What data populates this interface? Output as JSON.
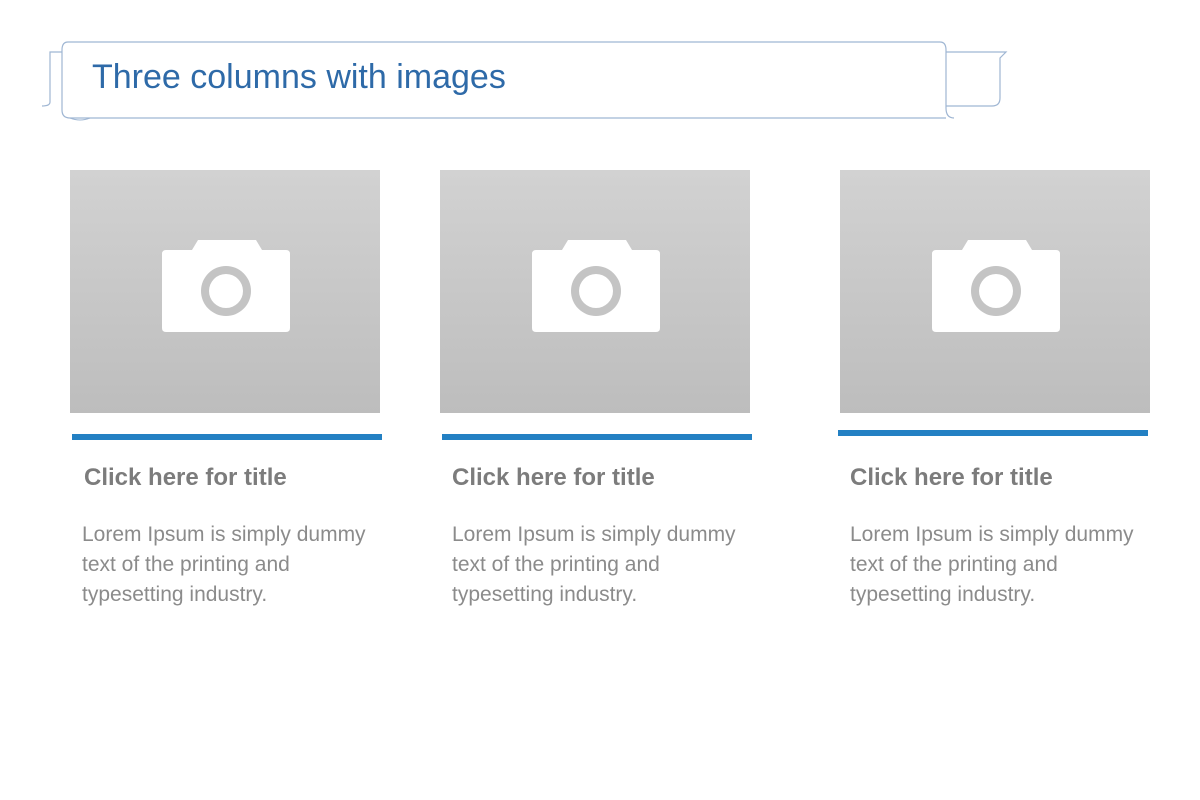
{
  "header": {
    "title": "Three columns with images"
  },
  "columns": [
    {
      "title": "Click here for title",
      "body": "Lorem Ipsum is simply dummy text of the printing and typesetting industry.",
      "image_icon": "camera-icon"
    },
    {
      "title": "Click here for title",
      "body": "Lorem Ipsum is simply dummy text of the printing and typesetting industry.",
      "image_icon": "camera-icon"
    },
    {
      "title": "Click here for title",
      "body": "Lorem Ipsum is simply dummy text of the printing and typesetting industry.",
      "image_icon": "camera-icon"
    }
  ],
  "colors": {
    "title_text": "#2e6aa8",
    "accent_bar": "#2380c3",
    "heading_text": "#7c7c7c",
    "body_text": "#8b8b8b",
    "placeholder_bg": "#c8c8c8"
  }
}
